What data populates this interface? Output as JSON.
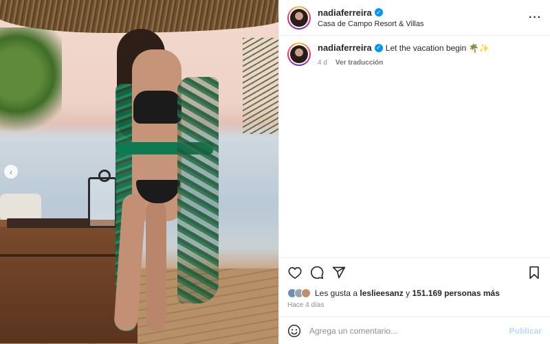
{
  "post": {
    "username": "nadiaferreira",
    "location": "Casa de Campo Resort & Villas",
    "more_label": "···",
    "carousel_prev_label": "‹",
    "caption": {
      "username": "nadiaferreira",
      "text": "Let the vacation begin 🌴✨",
      "age": "4 d",
      "translate_label": "Ver traducción"
    },
    "likes": {
      "prefix": "Les gusta a",
      "first_user": "leslieesanz",
      "connector": "y",
      "others": "151.169 personas más"
    },
    "date": "Hace 4 días",
    "comment_box": {
      "placeholder": "Agrega un comentario...",
      "publish_label": "Publicar"
    }
  },
  "icons": {
    "verified": "verified-badge-icon",
    "like": "heart-icon",
    "comment": "comment-icon",
    "share": "paper-plane-icon",
    "save": "bookmark-icon",
    "emoji": "smiley-icon",
    "more": "more-options-icon"
  },
  "colors": {
    "verified": "#0095f6",
    "publish_disabled": "#b3dbff",
    "secondary_text": "#8e8e8e"
  }
}
